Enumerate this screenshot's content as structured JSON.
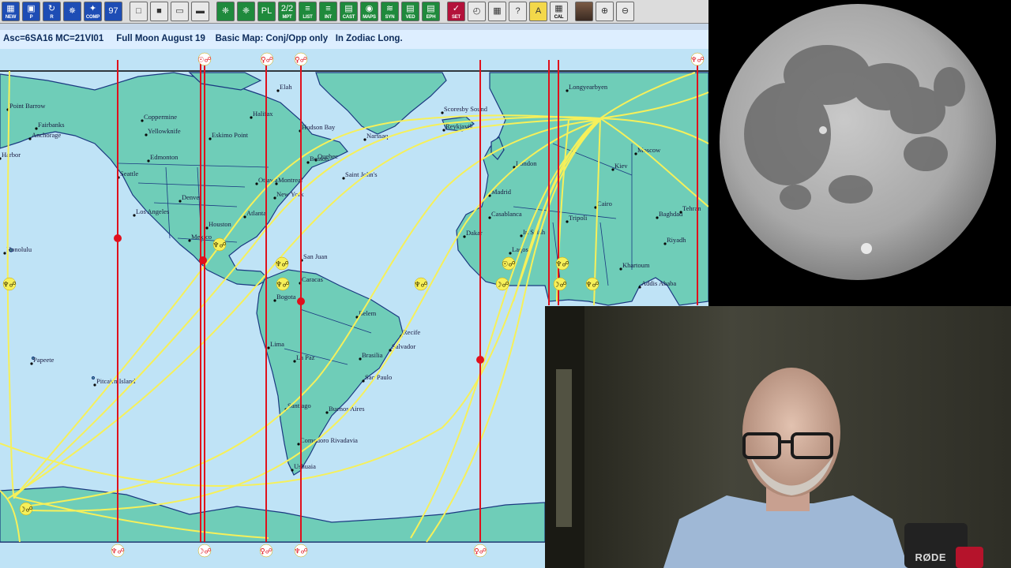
{
  "toolbar": {
    "buttons": [
      {
        "icon": "new-chart-icon",
        "glyph": "▦",
        "label": "NEW",
        "color": "blue"
      },
      {
        "icon": "print-icon",
        "glyph": "▣",
        "label": "P",
        "color": "blue"
      },
      {
        "icon": "redo-icon",
        "glyph": "↻",
        "label": "R",
        "color": "blue"
      },
      {
        "icon": "wheel-icon",
        "glyph": "✵",
        "label": "",
        "color": "blue"
      },
      {
        "icon": "compare-icon",
        "glyph": "✦",
        "label": "COMP",
        "color": "blue"
      },
      {
        "icon": "numbers-icon",
        "glyph": "97",
        "label": "",
        "color": "blue"
      },
      {
        "icon": "open-folder-icon",
        "glyph": "□",
        "label": "",
        "color": "gray"
      },
      {
        "icon": "save-icon",
        "glyph": "■",
        "label": "",
        "color": "gray"
      },
      {
        "icon": "clipboard-icon",
        "glyph": "▭",
        "label": "",
        "color": "gray"
      },
      {
        "icon": "document-icon",
        "glyph": "▬",
        "label": "",
        "color": "gray"
      },
      {
        "icon": "chart-wheel-icon",
        "glyph": "❈",
        "label": "",
        "color": "green"
      },
      {
        "icon": "aspect-grid-icon",
        "glyph": "❈",
        "label": "",
        "color": "green"
      },
      {
        "icon": "planet-list-icon",
        "glyph": "PL",
        "label": "",
        "color": "green"
      },
      {
        "icon": "midpoint-icon",
        "glyph": "2/2",
        "label": "MPT",
        "color": "green"
      },
      {
        "icon": "list-icon",
        "glyph": "≡",
        "label": "LIST",
        "color": "green"
      },
      {
        "icon": "interpretation-icon",
        "glyph": "≡",
        "label": "INT",
        "color": "green"
      },
      {
        "icon": "cast-icon",
        "glyph": "▤",
        "label": "CAST",
        "color": "green"
      },
      {
        "icon": "maps-icon",
        "glyph": "◉",
        "label": "MAPS",
        "color": "green"
      },
      {
        "icon": "synastry-icon",
        "glyph": "≋",
        "label": "SYN",
        "color": "green"
      },
      {
        "icon": "vedic-icon",
        "glyph": "▤",
        "label": "VED",
        "color": "green"
      },
      {
        "icon": "ephemeris-icon",
        "glyph": "▤",
        "label": "EPH",
        "color": "green"
      },
      {
        "icon": "settings-icon",
        "glyph": "✓",
        "label": "SET",
        "color": "red"
      },
      {
        "icon": "clock-icon",
        "glyph": "◴",
        "label": "",
        "color": "gray"
      },
      {
        "icon": "calendar-icon",
        "glyph": "▦",
        "label": "",
        "color": "gray"
      },
      {
        "icon": "help-icon",
        "glyph": "?",
        "label": "",
        "color": "gray"
      },
      {
        "icon": "atlas-icon",
        "glyph": "A",
        "label": "",
        "color": "yellow"
      },
      {
        "icon": "calculator-icon",
        "glyph": "▦",
        "label": "CAL",
        "color": "gray"
      },
      {
        "icon": "user-photo-icon",
        "glyph": "",
        "label": "",
        "color": "photo"
      },
      {
        "icon": "zoom-in-icon",
        "glyph": "⊕",
        "label": "",
        "color": "gray"
      },
      {
        "icon": "zoom-out-icon",
        "glyph": "⊖",
        "label": "",
        "color": "gray"
      }
    ]
  },
  "status_line": "Asc=6SA16 MC=21VI01     Full Moon August 19    Basic Map: Conj/Opp only   In Zodiac Long.",
  "map": {
    "city_labels": [
      "Point Barrow",
      "Fairbanks",
      "Anchorage",
      "Harbor",
      "Coppermine",
      "Yellowknife",
      "Edmonton",
      "Eskimo Point",
      "Seattle",
      "Los Angeles",
      "Denver",
      "Houston",
      "Mexico",
      "Honolulu",
      "Atlanta",
      "New York",
      "Montreal",
      "Quebec",
      "Boston",
      "Hudson Bay",
      "Ottawa",
      "Narssaq",
      "Scoresby Sound",
      "Reykjavik",
      "Saint John's",
      "San Juan",
      "Caracas",
      "Bogota",
      "Lima",
      "La Paz",
      "Belem",
      "Recife",
      "Salvador",
      "Brasilia",
      "Sao Paulo",
      "Santiago",
      "Buenos Aires",
      "Comodoro Rivadavia",
      "Ushuaia",
      "Papeete",
      "Pitcairn Island",
      "Longyearbyen",
      "London",
      "Madrid",
      "Casablanca",
      "In Salah",
      "Tripoli",
      "Moscow",
      "Kiev",
      "Baghdad",
      "Tehran",
      "Cairo",
      "Riyadh",
      "Khartoum",
      "Addis Ababa",
      "Dakar",
      "Lagos",
      "Elah",
      "Halifax"
    ],
    "top_glyphs": [
      "☉☍",
      "♀☍",
      "♀☍",
      "♆☍"
    ],
    "bottom_glyphs": [
      "♆☍",
      "☽☍",
      "♀☍",
      "♆☍",
      "♀☍"
    ],
    "line_glyphs": [
      "♆☍",
      "♆☍",
      "♆☍",
      "♆☍",
      "☉☍",
      "☽☍",
      "♆☍",
      "♆☍",
      "☽☍",
      "♆☍"
    ],
    "colors": {
      "ocean": "#bfe3f6",
      "land": "#6fcdb8",
      "border": "#1a3880",
      "mc_ic_line": "#e0101c",
      "asc_dsc_line": "#f6f05a"
    }
  },
  "webcam": {
    "brand": "RØDE"
  }
}
